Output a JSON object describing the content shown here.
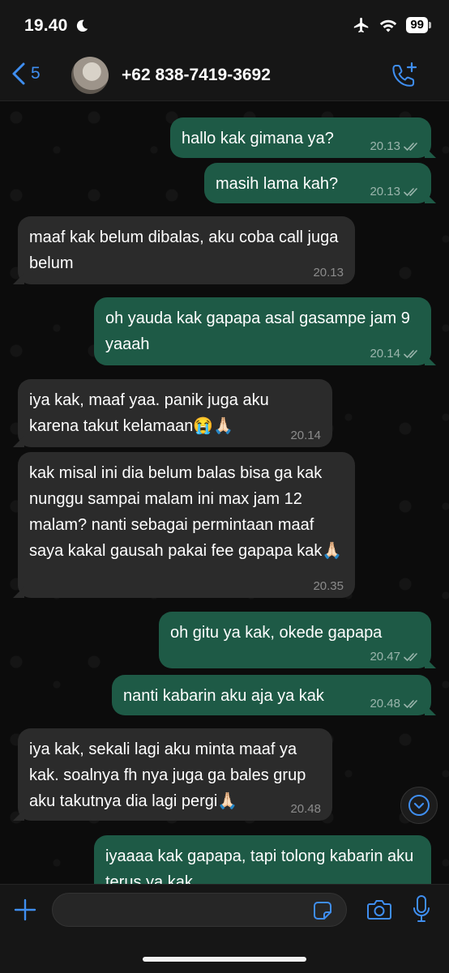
{
  "status_bar": {
    "time": "19.40",
    "battery": "99"
  },
  "header": {
    "back_count": "5",
    "contact_name": "+62 838-7419-3692"
  },
  "messages": [
    {
      "dir": "out",
      "text": "hallo kak gimana ya?",
      "time": "20.13"
    },
    {
      "dir": "out",
      "text": "masih lama kah?",
      "time": "20.13"
    },
    {
      "dir": "in",
      "text": "maaf kak belum dibalas, aku coba call juga belum",
      "time": "20.13"
    },
    {
      "dir": "out",
      "text": "oh yauda kak gapapa asal gasampe jam 9 yaaah",
      "time": "20.14"
    },
    {
      "dir": "in",
      "text": "iya kak, maaf yaa. panik juga aku karena takut kelamaan😭🙏🏻",
      "time": "20.14"
    },
    {
      "dir": "in",
      "text": "kak misal ini dia belum balas bisa ga kak nunggu sampai malam ini max jam 12 malam? nanti sebagai permintaan maaf saya kakal gausah pakai fee gapapa kak🙏🏻",
      "time": "20.35"
    },
    {
      "dir": "out",
      "text": "oh gitu ya kak, okede gapapa",
      "time": "20.47"
    },
    {
      "dir": "out",
      "text": "nanti kabarin aku aja ya kak",
      "time": "20.48"
    },
    {
      "dir": "in",
      "text": "iya kak, sekali lagi aku minta maaf ya kak. soalnya fh nya juga ga bales grup aku takutnya dia lagi pergi🙏🏻",
      "time": "20.48"
    },
    {
      "dir": "out",
      "text": "iyaaaa kak gapapa, tapi tolong kabarin aku terus ya kak",
      "time": ""
    }
  ],
  "composer": {
    "input_value": "",
    "input_placeholder": ""
  },
  "colors": {
    "outgoing_bubble": "#1e5a46",
    "incoming_bubble": "#2b2b2b",
    "accent": "#3f8ef0",
    "background": "#0c0c0c"
  },
  "icons": [
    "moon-icon",
    "airplane-icon",
    "wifi-icon",
    "chevron-left-icon",
    "call-add-icon",
    "double-check-icon",
    "chevron-down-icon",
    "plus-icon",
    "sticker-icon",
    "camera-icon",
    "mic-icon"
  ]
}
